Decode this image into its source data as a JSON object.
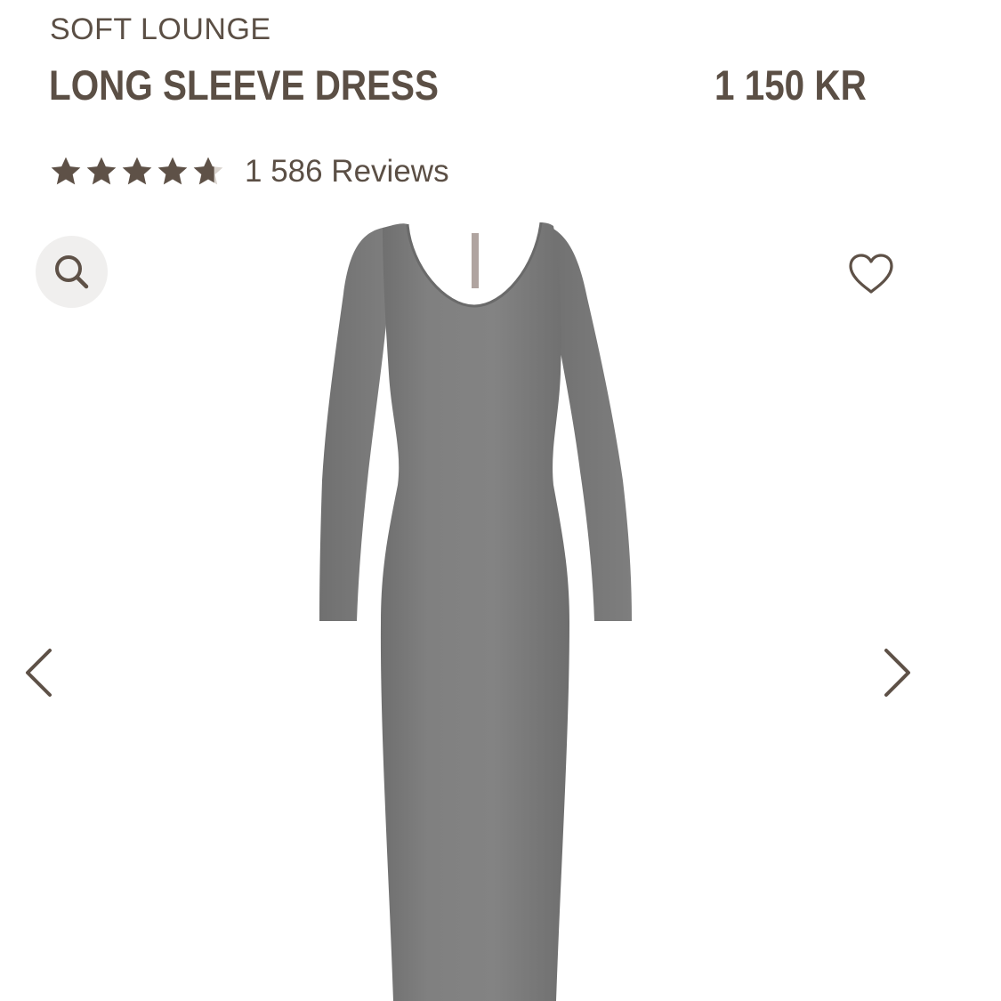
{
  "product": {
    "collection": "SOFT LOUNGE",
    "name": "LONG SLEEVE DRESS",
    "price": "1 150 KR",
    "rating": 4.7,
    "rating_max": 5,
    "review_count_label": "1 586 Reviews"
  },
  "icons": {
    "zoom": "search-icon",
    "wishlist": "heart-icon",
    "prev": "chevron-left-icon",
    "next": "chevron-right-icon",
    "star": "star-icon"
  },
  "colors": {
    "text": "#5b4f45",
    "star": "#5e5147",
    "dress": "#7d7d7d",
    "zoom_bg": "#f0efee"
  }
}
